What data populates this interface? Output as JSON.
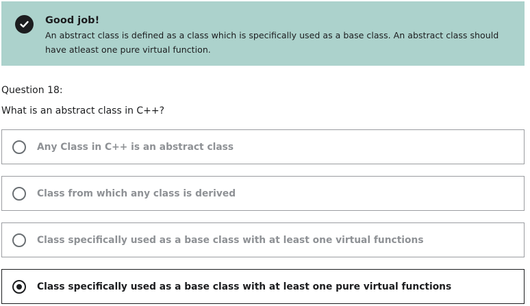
{
  "feedback": {
    "icon": "check-circle-icon",
    "title": "Good job!",
    "message": "An abstract class is defined as a class which is specifically used as a base class. An abstract class should have atleast one pure virtual function.",
    "background_color": "#acd2cc"
  },
  "question": {
    "number_label": "Question 18:",
    "text": "What is an abstract class in C++?"
  },
  "options": [
    {
      "label": "Any Class in C++ is an abstract class",
      "selected": false
    },
    {
      "label": "Class from which any class is derived",
      "selected": false
    },
    {
      "label": "Class specifically used as a base class with at least one virtual functions",
      "selected": false
    },
    {
      "label": "Class specifically used as a base class with at least one pure virtual functions",
      "selected": true
    }
  ]
}
